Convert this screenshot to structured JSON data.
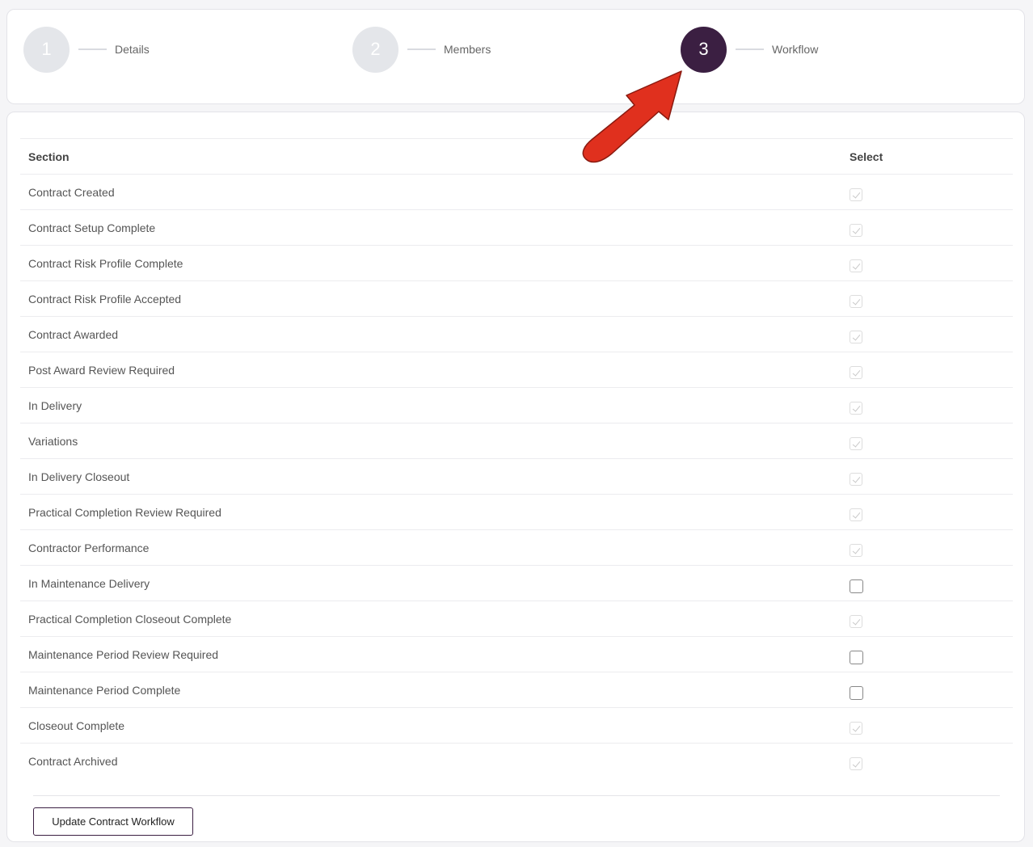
{
  "stepper": {
    "steps": [
      {
        "number": "1",
        "label": "Details"
      },
      {
        "number": "2",
        "label": "Members"
      },
      {
        "number": "3",
        "label": "Workflow"
      }
    ]
  },
  "table": {
    "headers": {
      "section": "Section",
      "select": "Select"
    },
    "rows": [
      {
        "section": "Contract Created",
        "checked": true
      },
      {
        "section": "Contract Setup Complete",
        "checked": true
      },
      {
        "section": "Contract Risk Profile Complete",
        "checked": true
      },
      {
        "section": "Contract Risk Profile Accepted",
        "checked": true
      },
      {
        "section": "Contract Awarded",
        "checked": true
      },
      {
        "section": "Post Award Review Required",
        "checked": true
      },
      {
        "section": "In Delivery",
        "checked": true
      },
      {
        "section": "Variations",
        "checked": true
      },
      {
        "section": "In Delivery Closeout",
        "checked": true
      },
      {
        "section": "Practical Completion Review Required",
        "checked": true
      },
      {
        "section": "Contractor Performance",
        "checked": true
      },
      {
        "section": "In Maintenance Delivery",
        "checked": false
      },
      {
        "section": "Practical Completion Closeout Complete",
        "checked": true
      },
      {
        "section": "Maintenance Period Review Required",
        "checked": false
      },
      {
        "section": "Maintenance Period Complete",
        "checked": false
      },
      {
        "section": "Closeout Complete",
        "checked": true
      },
      {
        "section": "Contract Archived",
        "checked": true
      }
    ]
  },
  "actions": {
    "update_label": "Update Contract Workflow"
  },
  "colors": {
    "active_step": "#3b1f42",
    "inactive_step": "#e4e6ea",
    "arrow": "#e0301e"
  }
}
